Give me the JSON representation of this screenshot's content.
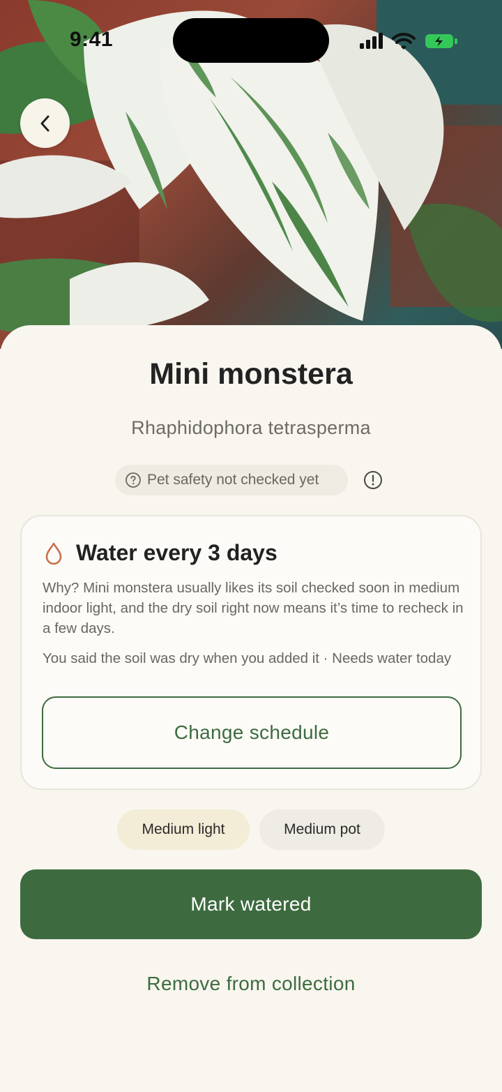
{
  "status_bar": {
    "time": "9:41"
  },
  "hero": {
    "icon": "back-chevron-icon"
  },
  "plant": {
    "name": "Mini monstera",
    "scientific_name": "Rhaphidophora tetrasperma"
  },
  "pet_safety": {
    "label": "Pet safety not checked yet",
    "icon": "question-circle-icon",
    "info_icon": "exclamation-circle-icon"
  },
  "water_card": {
    "icon": "water-drop-icon",
    "title": "Water every 3 days",
    "why": "Why? Mini monstera usually likes its soil checked soon in medium indoor light, and the dry soil right now means it’s time to recheck in a few days.",
    "note": "You said the soil was dry when you added it · Needs water today",
    "change_schedule_label": "Change schedule"
  },
  "chips": {
    "light": "Medium light",
    "pot": "Medium pot"
  },
  "actions": {
    "mark_watered_label": "Mark watered",
    "remove_label": "Remove from collection"
  },
  "colors": {
    "accent_green": "#3d6b3f",
    "background": "#f8f6ef",
    "drop_orange": "#c8714e",
    "battery_green": "#34c759"
  }
}
